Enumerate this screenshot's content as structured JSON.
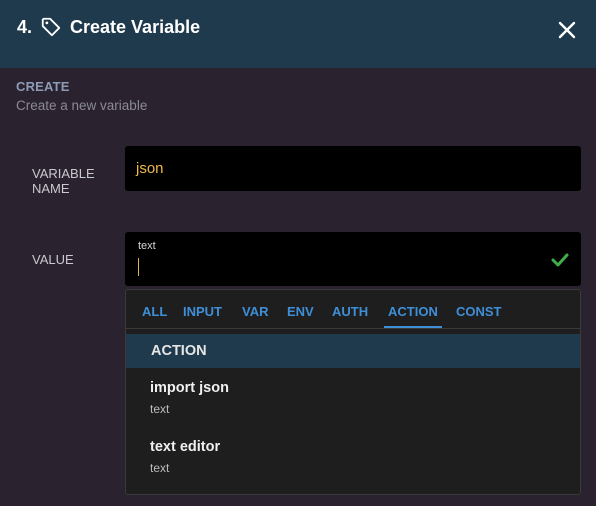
{
  "header": {
    "step": "4.",
    "title": "Create Variable"
  },
  "section": {
    "label": "CREATE",
    "subtitle": "Create a new variable"
  },
  "variable_name": {
    "label_line1": "VARIABLE",
    "label_line2": "NAME",
    "value": "json"
  },
  "value_field": {
    "label": "VALUE",
    "type_label": "text"
  },
  "tabs": [
    "ALL",
    "INPUT",
    "VAR",
    "ENV",
    "AUTH",
    "ACTION",
    "CONST"
  ],
  "active_tab": "ACTION",
  "group": {
    "title": "ACTION",
    "items": [
      {
        "title": "import json",
        "subtitle": "text"
      },
      {
        "title": "text editor",
        "subtitle": "text"
      }
    ]
  },
  "colors": {
    "accent": "#3f8fd8",
    "header_bg": "#1f3a4d",
    "input_text": "#f2b94a",
    "check": "#3fae4a"
  }
}
